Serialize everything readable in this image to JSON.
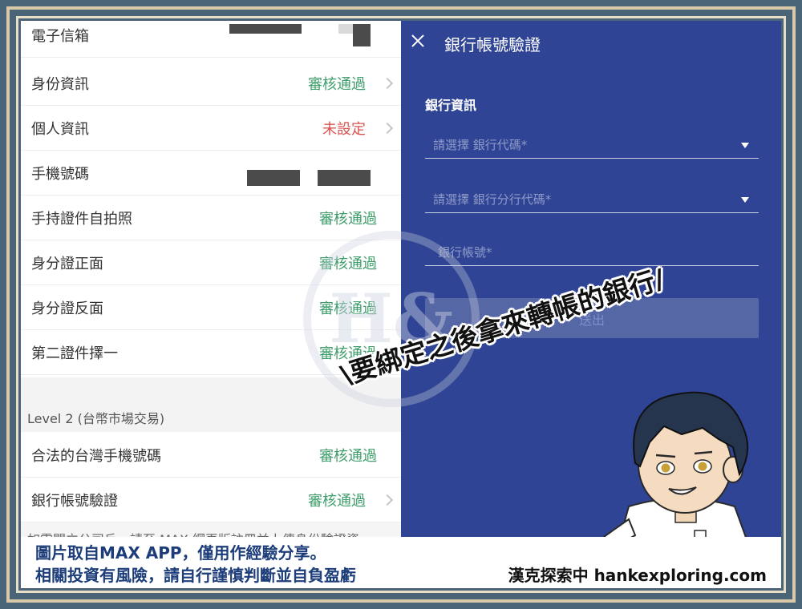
{
  "rows_top": [
    {
      "label": "電子信箱",
      "status": "",
      "status_type": "masked",
      "chevron": false
    },
    {
      "label": "身份資訊",
      "status": "審核通過",
      "status_type": "ok",
      "chevron": true
    },
    {
      "label": "個人資訊",
      "status": "未設定",
      "status_type": "unset",
      "chevron": true
    },
    {
      "label": "手機號碼",
      "status": "",
      "status_type": "masked",
      "chevron": false
    },
    {
      "label": "手持證件自拍照",
      "status": "審核通過",
      "status_type": "ok",
      "chevron": false
    },
    {
      "label": "身分證正面",
      "status": "審核通過",
      "status_type": "ok",
      "chevron": false
    },
    {
      "label": "身分證反面",
      "status": "審核通過",
      "status_type": "ok",
      "chevron": false
    },
    {
      "label": "第二證件擇一",
      "status": "審核通過",
      "status_type": "ok",
      "chevron": false
    }
  ],
  "level2": {
    "title": "Level 2 (台幣市場交易)",
    "rows": [
      {
        "label": "合法的台灣手機號碼",
        "status": "審核通過",
        "status_type": "ok",
        "chevron": false
      },
      {
        "label": "銀行帳號驗證",
        "status": "審核通過",
        "status_type": "ok",
        "chevron": true
      }
    ]
  },
  "footnote_cut": "如需開立公司戶，請至 MAX 網頁版註冊並上傳身份驗證資",
  "panel": {
    "title": "銀行帳號驗證",
    "section_label": "銀行資訊",
    "fields": [
      {
        "placeholder": "請選擇 銀行代碼*",
        "dropdown": true
      },
      {
        "placeholder": "請選擇 銀行分行代碼*",
        "dropdown": true
      },
      {
        "placeholder": "銀行帳號*",
        "dropdown": false
      }
    ],
    "submit_label": "送出"
  },
  "watermark_text": "H&",
  "callout": "\\要綁定之後拿來轉帳的銀行/",
  "caption": {
    "line1": "圖片取自MAX APP，僅用作經驗分享。",
    "line2": "相關投資有風險，請自行謹慎判斷並自負盈虧",
    "brand": "漢克探索中 hankexploring.com"
  },
  "colors": {
    "panel_bg": "#2f4494",
    "status_ok": "#3f9e6c",
    "status_unset": "#d9534f",
    "caption_blue": "#1c3d7a",
    "frame_bg": "#4a6478"
  }
}
